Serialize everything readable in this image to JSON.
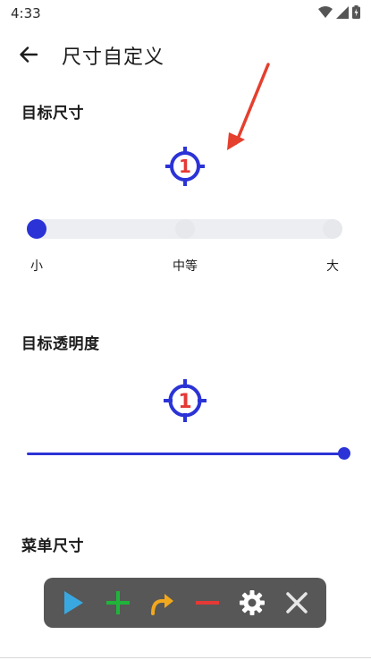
{
  "status_bar": {
    "time": "4:33"
  },
  "app_bar": {
    "title": "尺寸自定义"
  },
  "sections": {
    "target_size": {
      "title": "目标尺寸",
      "target_number": "1",
      "options": [
        "小",
        "中等",
        "大"
      ],
      "selected": "小"
    },
    "target_opacity": {
      "title": "目标透明度",
      "target_number": "1",
      "value_fraction": 1.0
    },
    "menu_size": {
      "title": "菜单尺寸"
    }
  },
  "menu": {
    "items": [
      "play-icon",
      "plus-icon",
      "swipe-arrow-icon",
      "minus-icon",
      "gear-icon",
      "close-icon"
    ]
  },
  "colors": {
    "accent": "#2b33d6",
    "target_number": "#e53935",
    "annotation_arrow": "#e53f2e",
    "menu_bg": "#575757",
    "play": "#3aa8e0",
    "plus": "#20b53a",
    "swipe": "#f2a81d",
    "minus": "#e53935"
  }
}
